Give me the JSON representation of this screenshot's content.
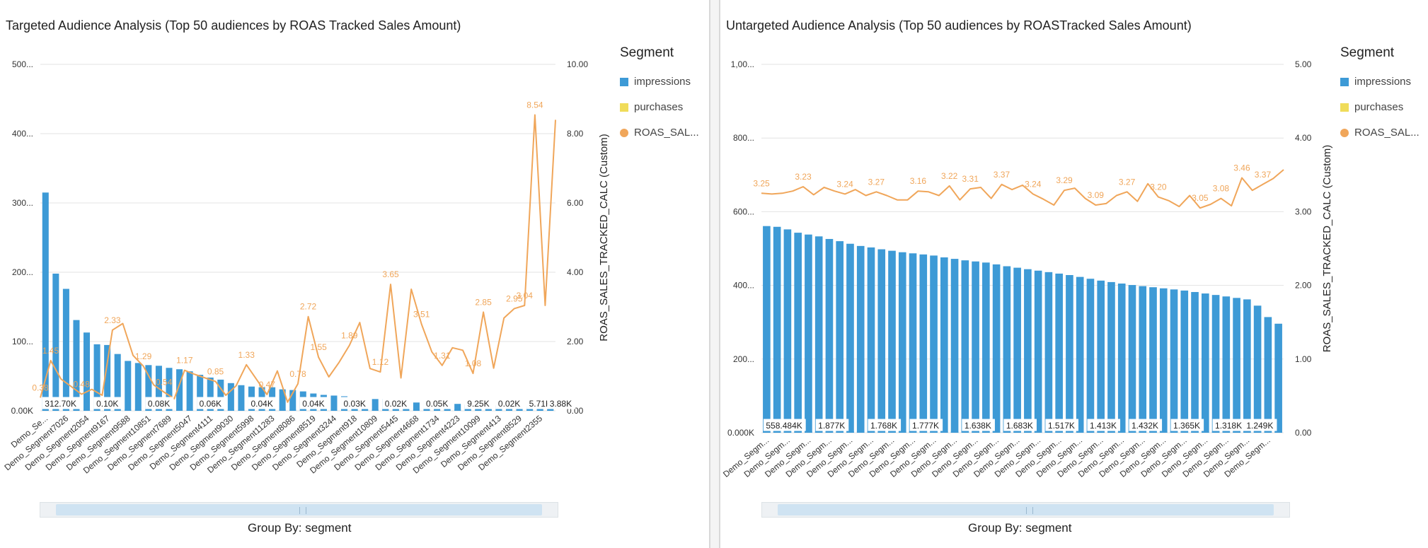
{
  "colors": {
    "impressions": "#3d9ad6",
    "purchases": "#f0dc5a",
    "roas": "#f0a65a",
    "grid": "#e3e3e3"
  },
  "icons": {
    "legend_square": "square-swatch",
    "legend_circle": "circle-swatch"
  },
  "chart_data": [
    {
      "type": "bar",
      "title": "Targeted Audience Analysis (Top 50 audiences by ROAS Tracked Sales Amount)",
      "xlabel": "Group By: segment",
      "ylabel": "",
      "y2label": "ROAS_SALES_TRACKED_CALC (Custom)",
      "legend_title": "Segment",
      "legend_position": "right",
      "grid": true,
      "ylim": [
        0,
        500
      ],
      "y2lim": [
        0,
        10
      ],
      "y_ticks": [
        "0.00K",
        "100...",
        "200...",
        "300...",
        "400...",
        "500..."
      ],
      "y2_ticks": [
        "0.00",
        "2.00",
        "4.00",
        "6.00",
        "8.00",
        "10.00"
      ],
      "categories": [
        "Demo_Se...",
        "Demo_Segment7026",
        "Demo_Segment2054",
        "Demo_Segment9167",
        "Demo_Segment9588",
        "Demo_Segment10851",
        "Demo_Segment7689",
        "Demo_Segment5047",
        "Demo_Segment4111",
        "Demo_Segment9030",
        "Demo_Segment5998",
        "Demo_Segment11283",
        "Demo_Segment8086",
        "Demo_Segment8519",
        "Demo_Segment3244",
        "Demo_Segment918",
        "Demo_Segment10809",
        "Demo_Segment5445",
        "Demo_Segment4668",
        "Demo_Segment1734",
        "Demo_Segment4223",
        "Demo_Segment10099",
        "Demo_Segment413",
        "Demo_Segment8529",
        "Demo_Segment2355"
      ],
      "series": [
        {
          "name": "impressions",
          "axis": "left",
          "kind": "bar",
          "values": [
            315,
            198,
            176,
            131,
            113,
            96,
            95,
            82,
            72,
            69,
            66,
            65,
            62,
            60,
            57,
            52,
            48,
            45,
            40,
            37,
            35,
            34,
            34,
            31,
            30,
            28,
            25,
            23,
            22,
            21,
            19,
            18,
            17,
            17,
            15,
            13,
            12,
            12,
            11,
            10,
            10,
            9,
            9,
            8,
            8,
            7,
            7,
            6,
            6,
            5
          ]
        },
        {
          "name": "purchases",
          "axis": "left",
          "kind": "bar",
          "values": []
        },
        {
          "name": "ROAS_SAL...",
          "axis": "right",
          "kind": "line",
          "values": [
            0.38,
            1.45,
            0.92,
            0.7,
            0.48,
            0.62,
            0.45,
            2.33,
            2.52,
            1.6,
            1.29,
            0.75,
            0.54,
            0.35,
            1.17,
            1.05,
            0.95,
            0.85,
            0.45,
            0.72,
            1.33,
            0.9,
            0.47,
            1.15,
            0.25,
            0.78,
            2.72,
            1.55,
            0.98,
            1.4,
            1.89,
            2.55,
            1.22,
            1.12,
            3.65,
            0.95,
            3.51,
            2.5,
            1.7,
            1.31,
            1.82,
            1.75,
            1.08,
            2.85,
            1.23,
            2.68,
            2.95,
            3.04,
            8.54,
            3.04,
            8.4
          ]
        }
      ],
      "point_labels": [
        {
          "index": 0,
          "text": "0.38"
        },
        {
          "index": 1,
          "text": "1.45"
        },
        {
          "index": 4,
          "text": "0.48"
        },
        {
          "index": 7,
          "text": "2.33"
        },
        {
          "index": 10,
          "text": "1.29"
        },
        {
          "index": 12,
          "text": "0.54"
        },
        {
          "index": 14,
          "text": "1.17"
        },
        {
          "index": 17,
          "text": "0.85"
        },
        {
          "index": 20,
          "text": "1.33"
        },
        {
          "index": 22,
          "text": "0.47"
        },
        {
          "index": 25,
          "text": "0.78"
        },
        {
          "index": 26,
          "text": "2.72"
        },
        {
          "index": 27,
          "text": "1.55"
        },
        {
          "index": 30,
          "text": "1.89"
        },
        {
          "index": 33,
          "text": "1.12"
        },
        {
          "index": 34,
          "text": "3.65"
        },
        {
          "index": 37,
          "text": "3.51"
        },
        {
          "index": 39,
          "text": "1.31"
        },
        {
          "index": 42,
          "text": "1.08"
        },
        {
          "index": 43,
          "text": "2.85"
        },
        {
          "index": 46,
          "text": "2.95"
        },
        {
          "index": 47,
          "text": "3.04"
        },
        {
          "index": 48,
          "text": "8.54"
        }
      ],
      "bar_labels": [
        {
          "index": 0,
          "text": "312.70K"
        },
        {
          "index": 5,
          "text": "0.10K"
        },
        {
          "index": 10,
          "text": "0.08K"
        },
        {
          "index": 15,
          "text": "0.06K"
        },
        {
          "index": 20,
          "text": "0.04K"
        },
        {
          "index": 25,
          "text": "0.04K"
        },
        {
          "index": 29,
          "text": "0.03K"
        },
        {
          "index": 33,
          "text": "0.02K"
        },
        {
          "index": 37,
          "text": "0.05K"
        },
        {
          "index": 41,
          "text": "9.25K"
        },
        {
          "index": 44,
          "text": "0.02K"
        },
        {
          "index": 47,
          "text": "5.71K"
        },
        {
          "index": 49,
          "text": "3.88K"
        }
      ]
    },
    {
      "type": "bar",
      "title": "Untargeted Audience Analysis (Top 50 audiences by ROASTracked Sales Amount)",
      "xlabel": "Group By: segment",
      "ylabel": "",
      "y2label": "ROAS_SALES_TRACKED_CALC (Custom)",
      "legend_title": "Segment",
      "legend_position": "right",
      "grid": true,
      "ylim": [
        0,
        1000
      ],
      "y2lim": [
        0,
        5
      ],
      "y_ticks": [
        "0.000K",
        "200...",
        "400...",
        "600...",
        "800...",
        "1,00..."
      ],
      "y2_ticks": [
        "0.00",
        "1.00",
        "2.00",
        "3.00",
        "4.00",
        "5.00"
      ],
      "categories": [
        "Demo_Segm...",
        "Demo_Segm...",
        "Demo_Segm...",
        "Demo_Segm...",
        "Demo_Segm...",
        "Demo_Segm...",
        "Demo_Segm...",
        "Demo_Segm...",
        "Demo_Segm...",
        "Demo_Segm...",
        "Demo_Segm...",
        "Demo_Segm...",
        "Demo_Segm...",
        "Demo_Segm...",
        "Demo_Segm...",
        "Demo_Segm...",
        "Demo_Segm...",
        "Demo_Segm...",
        "Demo_Segm...",
        "Demo_Segm...",
        "Demo_Segm...",
        "Demo_Segm...",
        "Demo_Segm...",
        "Demo_Segm...",
        "Demo_Segm..."
      ],
      "series": [
        {
          "name": "impressions",
          "axis": "left",
          "kind": "bar",
          "values": [
            561,
            559,
            552,
            543,
            538,
            533,
            526,
            520,
            513,
            507,
            503,
            498,
            494,
            490,
            487,
            484,
            481,
            476,
            472,
            468,
            465,
            462,
            457,
            452,
            448,
            444,
            440,
            436,
            432,
            428,
            423,
            418,
            413,
            409,
            405,
            401,
            398,
            395,
            392,
            389,
            386,
            382,
            378,
            374,
            370,
            366,
            362,
            345,
            314,
            296
          ]
        },
        {
          "name": "purchases",
          "axis": "left",
          "kind": "bar",
          "values": []
        },
        {
          "name": "ROAS_SAL...",
          "axis": "right",
          "kind": "line",
          "values": [
            3.25,
            3.24,
            3.25,
            3.28,
            3.34,
            3.23,
            3.33,
            3.28,
            3.24,
            3.3,
            3.22,
            3.27,
            3.22,
            3.16,
            3.16,
            3.28,
            3.27,
            3.22,
            3.35,
            3.16,
            3.31,
            3.33,
            3.18,
            3.37,
            3.3,
            3.36,
            3.24,
            3.17,
            3.09,
            3.29,
            3.32,
            3.18,
            3.09,
            3.11,
            3.22,
            3.27,
            3.14,
            3.38,
            3.2,
            3.15,
            3.07,
            3.22,
            3.05,
            3.1,
            3.18,
            3.08,
            3.46,
            3.29,
            3.37,
            3.45,
            3.57
          ]
        }
      ],
      "point_labels": [
        {
          "index": 0,
          "text": "3.25"
        },
        {
          "index": 4,
          "text": "3.23"
        },
        {
          "index": 8,
          "text": "3.24"
        },
        {
          "index": 11,
          "text": "3.27"
        },
        {
          "index": 15,
          "text": "3.16"
        },
        {
          "index": 18,
          "text": "3.22"
        },
        {
          "index": 20,
          "text": "3.31"
        },
        {
          "index": 23,
          "text": "3.37"
        },
        {
          "index": 26,
          "text": "3.24"
        },
        {
          "index": 29,
          "text": "3.29"
        },
        {
          "index": 32,
          "text": "3.09"
        },
        {
          "index": 35,
          "text": "3.27"
        },
        {
          "index": 38,
          "text": "3.20"
        },
        {
          "index": 42,
          "text": "3.05"
        },
        {
          "index": 44,
          "text": "3.08"
        },
        {
          "index": 46,
          "text": "3.46"
        },
        {
          "index": 48,
          "text": "3.37"
        }
      ],
      "bar_labels": [
        {
          "index": 0,
          "text": "558.484K"
        },
        {
          "index": 5,
          "text": "1.877K"
        },
        {
          "index": 10,
          "text": "1.768K"
        },
        {
          "index": 14,
          "text": "1.777K"
        },
        {
          "index": 19,
          "text": "1.638K"
        },
        {
          "index": 23,
          "text": "1.683K"
        },
        {
          "index": 27,
          "text": "1.517K"
        },
        {
          "index": 31,
          "text": "1.413K"
        },
        {
          "index": 35,
          "text": "1.432K"
        },
        {
          "index": 39,
          "text": "1.365K"
        },
        {
          "index": 43,
          "text": "1.318K"
        },
        {
          "index": 46,
          "text": "1.249K"
        }
      ]
    }
  ],
  "legend": {
    "title": "Segment",
    "items": [
      {
        "label": "impressions",
        "shape": "square",
        "color": "#3d9ad6"
      },
      {
        "label": "purchases",
        "shape": "square",
        "color": "#f0dc5a"
      },
      {
        "label": "ROAS_SAL...",
        "shape": "circle",
        "color": "#f0a65a"
      }
    ]
  }
}
